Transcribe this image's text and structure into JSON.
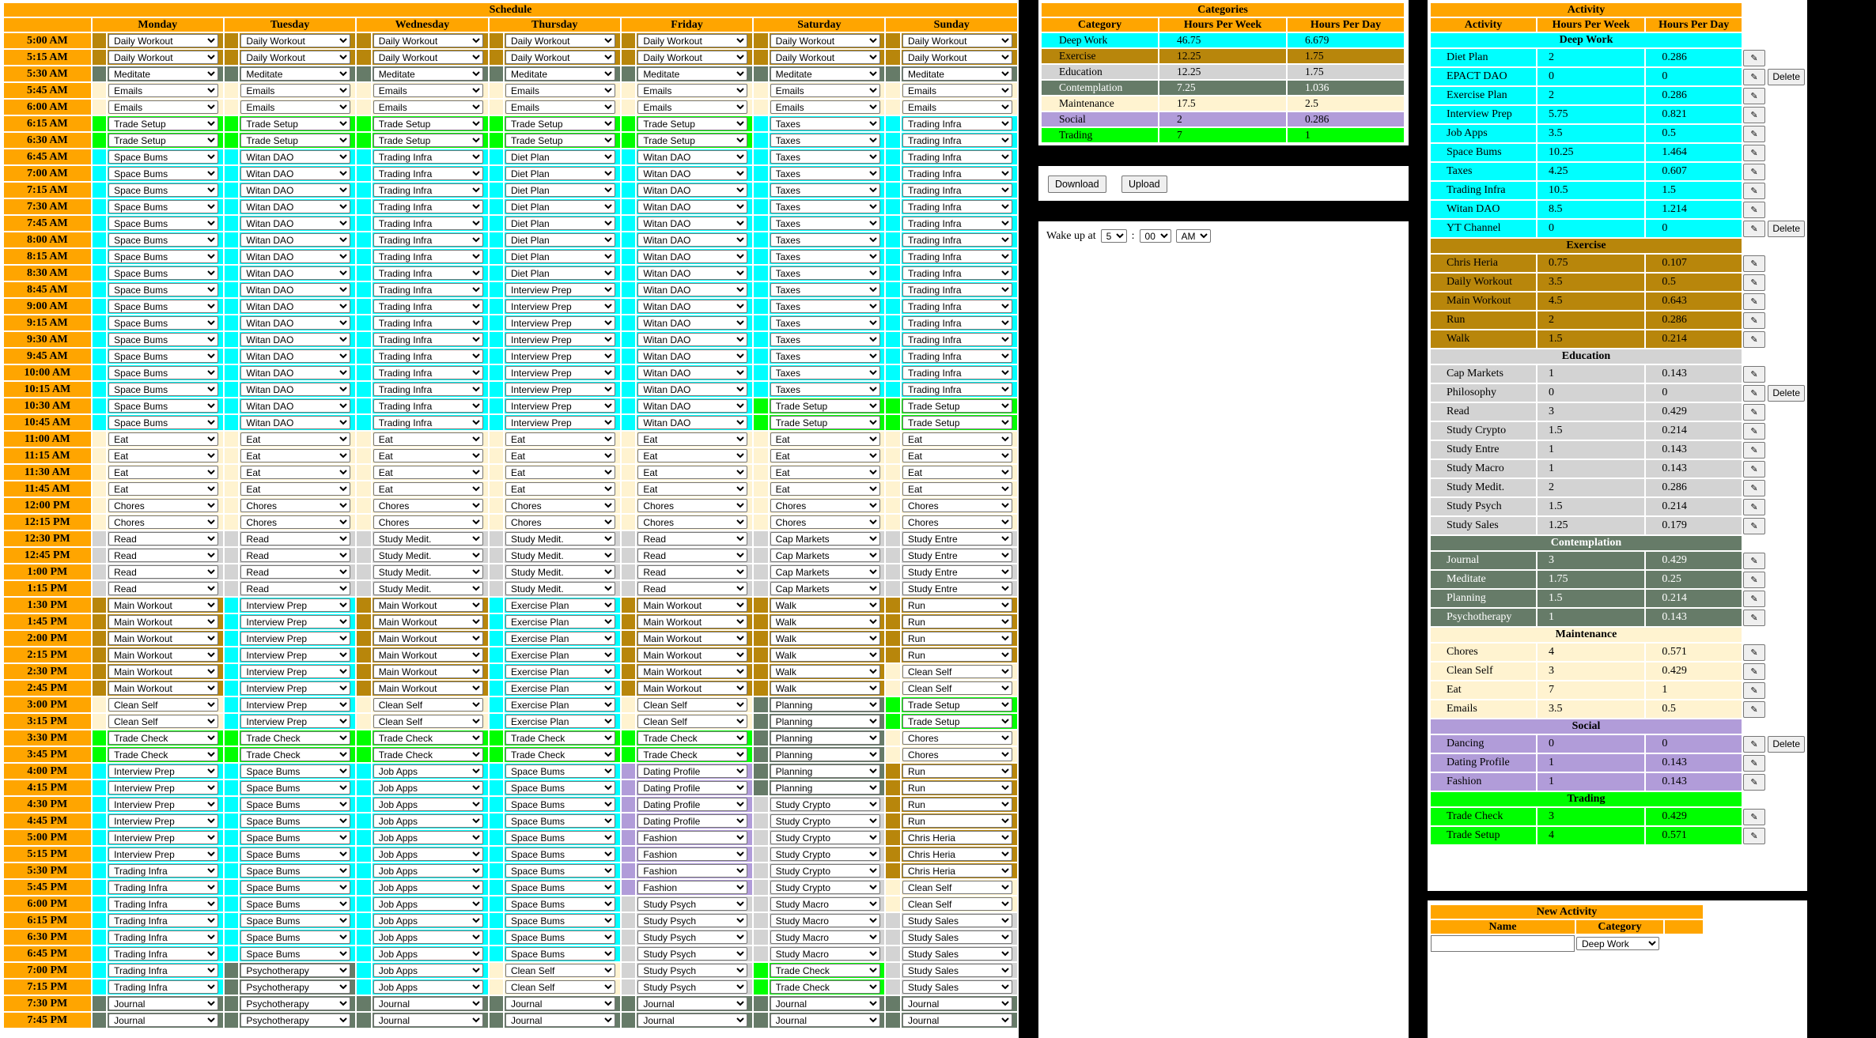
{
  "colors": {
    "Deep Work": "#00ffff",
    "Exercise": "#b8860b",
    "Education": "#d3d3d3",
    "Contemplation": "#667b68",
    "Maintenance": "#fff3d0",
    "Social": "#b19cd9",
    "Trading": "#00ff00",
    "header": "#ffa500"
  },
  "activity_category": {
    "Diet Plan": "Deep Work",
    "EPACT DAO": "Deep Work",
    "Exercise Plan": "Deep Work",
    "Interview Prep": "Deep Work",
    "Job Apps": "Deep Work",
    "Space Bums": "Deep Work",
    "Taxes": "Deep Work",
    "Trading Infra": "Deep Work",
    "Witan DAO": "Deep Work",
    "YT Channel": "Deep Work",
    "Chris Heria": "Exercise",
    "Daily Workout": "Exercise",
    "Main Workout": "Exercise",
    "Run": "Exercise",
    "Walk": "Exercise",
    "Cap Markets": "Education",
    "Philosophy": "Education",
    "Read": "Education",
    "Study Crypto": "Education",
    "Study Entre": "Education",
    "Study Macro": "Education",
    "Study Medit.": "Education",
    "Study Psych": "Education",
    "Study Sales": "Education",
    "Journal": "Contemplation",
    "Meditate": "Contemplation",
    "Planning": "Contemplation",
    "Psychotherapy": "Contemplation",
    "Chores": "Maintenance",
    "Clean Self": "Maintenance",
    "Eat": "Maintenance",
    "Emails": "Maintenance",
    "Dancing": "Social",
    "Dating Profile": "Social",
    "Fashion": "Social",
    "Trade Check": "Trading",
    "Trade Setup": "Trading"
  },
  "schedule": {
    "title": "Schedule",
    "days": [
      "Monday",
      "Tuesday",
      "Wednesday",
      "Thursday",
      "Friday",
      "Saturday",
      "Sunday"
    ],
    "abbr": {
      "DW": "Daily Workout",
      "MD": "Meditate",
      "EM": "Emails",
      "TS": "Trade Setup",
      "TX": "Taxes",
      "TI": "Trading Infra",
      "SB": "Space Bums",
      "WD": "Witan DAO",
      "DP": "Diet Plan",
      "IP": "Interview Prep",
      "EA": "Eat",
      "CH": "Chores",
      "RD": "Read",
      "SM": "Study Medit.",
      "CM": "Cap Markets",
      "SE": "Study Entre",
      "MW": "Main Workout",
      "EP": "Exercise Plan",
      "WK": "Walk",
      "RN": "Run",
      "CS": "Clean Self",
      "PL": "Planning",
      "TC": "Trade Check",
      "JA": "Job Apps",
      "DF": "Dating Profile",
      "SC": "Study Crypto",
      "CR": "Chris Heria",
      "FS": "Fashion",
      "SP": "Study Psych",
      "SX": "Study Macro",
      "SS": "Study Sales",
      "PT": "Psychotherapy",
      "JR": "Journal"
    },
    "rows": [
      {
        "time": "5:00 AM",
        "acts": "DW DW DW DW DW DW DW"
      },
      {
        "time": "5:15 AM",
        "acts": "DW DW DW DW DW DW DW"
      },
      {
        "time": "5:30 AM",
        "acts": "MD MD MD MD MD MD MD"
      },
      {
        "time": "5:45 AM",
        "acts": "EM EM EM EM EM EM EM"
      },
      {
        "time": "6:00 AM",
        "acts": "EM EM EM EM EM EM EM"
      },
      {
        "time": "6:15 AM",
        "acts": "TS TS TS TS TS TX TI"
      },
      {
        "time": "6:30 AM",
        "acts": "TS TS TS TS TS TX TI"
      },
      {
        "time": "6:45 AM",
        "acts": "SB WD TI DP WD TX TI"
      },
      {
        "time": "7:00 AM",
        "acts": "SB WD TI DP WD TX TI"
      },
      {
        "time": "7:15 AM",
        "acts": "SB WD TI DP WD TX TI"
      },
      {
        "time": "7:30 AM",
        "acts": "SB WD TI DP WD TX TI"
      },
      {
        "time": "7:45 AM",
        "acts": "SB WD TI DP WD TX TI"
      },
      {
        "time": "8:00 AM",
        "acts": "SB WD TI DP WD TX TI"
      },
      {
        "time": "8:15 AM",
        "acts": "SB WD TI DP WD TX TI"
      },
      {
        "time": "8:30 AM",
        "acts": "SB WD TI DP WD TX TI"
      },
      {
        "time": "8:45 AM",
        "acts": "SB WD TI IP WD TX TI"
      },
      {
        "time": "9:00 AM",
        "acts": "SB WD TI IP WD TX TI"
      },
      {
        "time": "9:15 AM",
        "acts": "SB WD TI IP WD TX TI"
      },
      {
        "time": "9:30 AM",
        "acts": "SB WD TI IP WD TX TI"
      },
      {
        "time": "9:45 AM",
        "acts": "SB WD TI IP WD TX TI"
      },
      {
        "time": "10:00 AM",
        "acts": "SB WD TI IP WD TX TI"
      },
      {
        "time": "10:15 AM",
        "acts": "SB WD TI IP WD TX TI"
      },
      {
        "time": "10:30 AM",
        "acts": "SB WD TI IP WD TS TS"
      },
      {
        "time": "10:45 AM",
        "acts": "SB WD TI IP WD TS TS"
      },
      {
        "time": "11:00 AM",
        "acts": "EA EA EA EA EA EA EA"
      },
      {
        "time": "11:15 AM",
        "acts": "EA EA EA EA EA EA EA"
      },
      {
        "time": "11:30 AM",
        "acts": "EA EA EA EA EA EA EA"
      },
      {
        "time": "11:45 AM",
        "acts": "EA EA EA EA EA EA EA"
      },
      {
        "time": "12:00 PM",
        "acts": "CH CH CH CH CH CH CH"
      },
      {
        "time": "12:15 PM",
        "acts": "CH CH CH CH CH CH CH"
      },
      {
        "time": "12:30 PM",
        "acts": "RD RD SM SM RD CM SE"
      },
      {
        "time": "12:45 PM",
        "acts": "RD RD SM SM RD CM SE"
      },
      {
        "time": "1:00 PM",
        "acts": "RD RD SM SM RD CM SE"
      },
      {
        "time": "1:15 PM",
        "acts": "RD RD SM SM RD CM SE"
      },
      {
        "time": "1:30 PM",
        "acts": "MW IP MW EP MW WK RN"
      },
      {
        "time": "1:45 PM",
        "acts": "MW IP MW EP MW WK RN"
      },
      {
        "time": "2:00 PM",
        "acts": "MW IP MW EP MW WK RN"
      },
      {
        "time": "2:15 PM",
        "acts": "MW IP MW EP MW WK RN"
      },
      {
        "time": "2:30 PM",
        "acts": "MW IP MW EP MW WK CS"
      },
      {
        "time": "2:45 PM",
        "acts": "MW IP MW EP MW WK CS"
      },
      {
        "time": "3:00 PM",
        "acts": "CS IP CS EP CS PL TS"
      },
      {
        "time": "3:15 PM",
        "acts": "CS IP CS EP CS PL TS"
      },
      {
        "time": "3:30 PM",
        "acts": "TC TC TC TC TC PL CH"
      },
      {
        "time": "3:45 PM",
        "acts": "TC TC TC TC TC PL CH"
      },
      {
        "time": "4:00 PM",
        "acts": "IP SB JA SB DF PL RN"
      },
      {
        "time": "4:15 PM",
        "acts": "IP SB JA SB DF PL RN"
      },
      {
        "time": "4:30 PM",
        "acts": "IP SB JA SB DF SC RN"
      },
      {
        "time": "4:45 PM",
        "acts": "IP SB JA SB DF SC RN"
      },
      {
        "time": "5:00 PM",
        "acts": "IP SB JA SB FS SC CR"
      },
      {
        "time": "5:15 PM",
        "acts": "IP SB JA SB FS SC CR"
      },
      {
        "time": "5:30 PM",
        "acts": "TI SB JA SB FS SC CR"
      },
      {
        "time": "5:45 PM",
        "acts": "TI SB JA SB FS SC CS"
      },
      {
        "time": "6:00 PM",
        "acts": "TI SB JA SB SP SX CS"
      },
      {
        "time": "6:15 PM",
        "acts": "TI SB JA SB SP SX SS"
      },
      {
        "time": "6:30 PM",
        "acts": "TI SB JA SB SP SX SS"
      },
      {
        "time": "6:45 PM",
        "acts": "TI SB JA SB SP SX SS"
      },
      {
        "time": "7:00 PM",
        "acts": "TI PT JA CS SP TC SS"
      },
      {
        "time": "7:15 PM",
        "acts": "TI PT JA CS SP TC SS"
      },
      {
        "time": "7:30 PM",
        "acts": "JR PT JR JR JR JR JR"
      },
      {
        "time": "7:45 PM",
        "acts": "JR PT JR JR JR JR JR"
      }
    ]
  },
  "categories": {
    "title": "Categories",
    "headers": [
      "Category",
      "Hours Per Week",
      "Hours Per Day"
    ],
    "rows": [
      {
        "name": "Deep Work",
        "week": "46.75",
        "day": "6.679"
      },
      {
        "name": "Exercise",
        "week": "12.25",
        "day": "1.75"
      },
      {
        "name": "Education",
        "week": "12.25",
        "day": "1.75"
      },
      {
        "name": "Contemplation",
        "week": "7.25",
        "day": "1.036"
      },
      {
        "name": "Maintenance",
        "week": "17.5",
        "day": "2.5"
      },
      {
        "name": "Social",
        "week": "2",
        "day": "0.286"
      },
      {
        "name": "Trading",
        "week": "7",
        "day": "1"
      }
    ]
  },
  "io": {
    "download_label": "Download",
    "upload_label": "Upload"
  },
  "wake": {
    "label": "Wake up at",
    "hour": "5",
    "sep": ":",
    "minute": "00",
    "ampm": "AM"
  },
  "activity": {
    "title": "Activity",
    "headers": [
      "Activity",
      "Hours Per Week",
      "Hours Per Day"
    ],
    "edit_icon": "pencil-icon",
    "delete_label": "Delete",
    "groups": [
      {
        "name": "Deep Work",
        "items": [
          {
            "name": "Diet Plan",
            "week": "2",
            "day": "0.286"
          },
          {
            "name": "EPACT DAO",
            "week": "0",
            "day": "0",
            "del": true
          },
          {
            "name": "Exercise Plan",
            "week": "2",
            "day": "0.286"
          },
          {
            "name": "Interview Prep",
            "week": "5.75",
            "day": "0.821"
          },
          {
            "name": "Job Apps",
            "week": "3.5",
            "day": "0.5"
          },
          {
            "name": "Space Bums",
            "week": "10.25",
            "day": "1.464"
          },
          {
            "name": "Taxes",
            "week": "4.25",
            "day": "0.607"
          },
          {
            "name": "Trading Infra",
            "week": "10.5",
            "day": "1.5"
          },
          {
            "name": "Witan DAO",
            "week": "8.5",
            "day": "1.214"
          },
          {
            "name": "YT Channel",
            "week": "0",
            "day": "0",
            "del": true
          }
        ]
      },
      {
        "name": "Exercise",
        "items": [
          {
            "name": "Chris Heria",
            "week": "0.75",
            "day": "0.107"
          },
          {
            "name": "Daily Workout",
            "week": "3.5",
            "day": "0.5"
          },
          {
            "name": "Main Workout",
            "week": "4.5",
            "day": "0.643"
          },
          {
            "name": "Run",
            "week": "2",
            "day": "0.286"
          },
          {
            "name": "Walk",
            "week": "1.5",
            "day": "0.214"
          }
        ]
      },
      {
        "name": "Education",
        "items": [
          {
            "name": "Cap Markets",
            "week": "1",
            "day": "0.143"
          },
          {
            "name": "Philosophy",
            "week": "0",
            "day": "0",
            "del": true
          },
          {
            "name": "Read",
            "week": "3",
            "day": "0.429"
          },
          {
            "name": "Study Crypto",
            "week": "1.5",
            "day": "0.214"
          },
          {
            "name": "Study Entre",
            "week": "1",
            "day": "0.143"
          },
          {
            "name": "Study Macro",
            "week": "1",
            "day": "0.143"
          },
          {
            "name": "Study Medit.",
            "week": "2",
            "day": "0.286"
          },
          {
            "name": "Study Psych",
            "week": "1.5",
            "day": "0.214"
          },
          {
            "name": "Study Sales",
            "week": "1.25",
            "day": "0.179"
          }
        ]
      },
      {
        "name": "Contemplation",
        "items": [
          {
            "name": "Journal",
            "week": "3",
            "day": "0.429"
          },
          {
            "name": "Meditate",
            "week": "1.75",
            "day": "0.25"
          },
          {
            "name": "Planning",
            "week": "1.5",
            "day": "0.214"
          },
          {
            "name": "Psychotherapy",
            "week": "1",
            "day": "0.143"
          }
        ]
      },
      {
        "name": "Maintenance",
        "items": [
          {
            "name": "Chores",
            "week": "4",
            "day": "0.571"
          },
          {
            "name": "Clean Self",
            "week": "3",
            "day": "0.429"
          },
          {
            "name": "Eat",
            "week": "7",
            "day": "1"
          },
          {
            "name": "Emails",
            "week": "3.5",
            "day": "0.5"
          }
        ]
      },
      {
        "name": "Social",
        "items": [
          {
            "name": "Dancing",
            "week": "0",
            "day": "0",
            "del": true
          },
          {
            "name": "Dating Profile",
            "week": "1",
            "day": "0.143"
          },
          {
            "name": "Fashion",
            "week": "1",
            "day": "0.143"
          }
        ]
      },
      {
        "name": "Trading",
        "items": [
          {
            "name": "Trade Check",
            "week": "3",
            "day": "0.429"
          },
          {
            "name": "Trade Setup",
            "week": "4",
            "day": "0.571"
          }
        ]
      }
    ]
  },
  "new_activity": {
    "title": "New Activity",
    "headers": [
      "Name",
      "Category"
    ],
    "name_value": "",
    "category_value": "Deep Work"
  }
}
